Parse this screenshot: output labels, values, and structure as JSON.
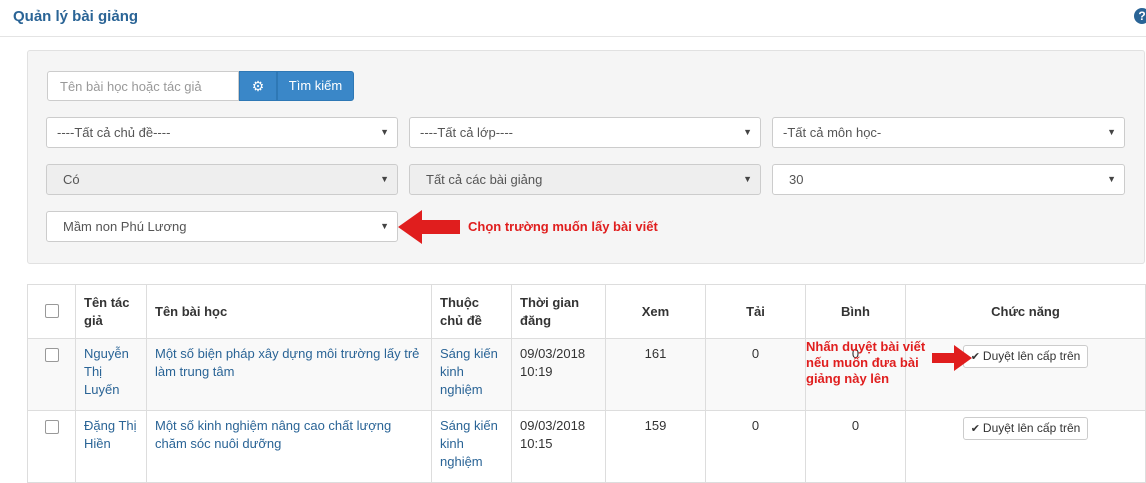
{
  "header": {
    "title": "Quản lý bài giảng",
    "help_icon": "?"
  },
  "search": {
    "placeholder": "Tên bài học hoặc tác giả",
    "gear_icon": "⚙",
    "button_label": "Tìm kiếm"
  },
  "filters": {
    "topic": "----Tất cả chủ đề----",
    "class": "----Tất cả lớp----",
    "subject": "-Tất cả môn học-",
    "status": "Có",
    "lesson_type": "Tất cả các bài giảng",
    "page_size": "30",
    "school": "Mầm non Phú Lương"
  },
  "annotations": {
    "school_hint": "Chọn trường muốn lấy bài viết",
    "approve_hint": "Nhấn duyệt bài viết nếu muốn đưa bài giảng này lên"
  },
  "table": {
    "columns": {
      "author": "Tên tác giả",
      "lesson": "Tên bài học",
      "topic": "Thuộc chủ đề",
      "posted": "Thời gian đăng",
      "views": "Xem",
      "downloads": "Tải",
      "comments": "Bình",
      "actions": "Chức năng"
    },
    "rows": [
      {
        "author": "Nguyễn Thị Luyến",
        "lesson": "Một số biện pháp xây dựng môi trường lấy trẻ làm trung tâm",
        "topic": "Sáng kiến kinh nghiệm",
        "posted": "09/03/2018 10:19",
        "views": "161",
        "downloads": "0",
        "comments": "0",
        "action": "Duyệt lên cấp trên"
      },
      {
        "author": "Đặng Thị Hiền",
        "lesson": "Một số kinh nghiệm nâng cao chất lượng chăm sóc nuôi dưỡng",
        "topic": "Sáng kiến kinh nghiệm",
        "posted": "09/03/2018 10:15",
        "views": "159",
        "downloads": "0",
        "comments": "0",
        "action": "Duyệt lên cấp trên"
      }
    ]
  },
  "colors": {
    "accent": "#3a87c8",
    "link": "#2a6496",
    "annotation": "#e01e1e"
  }
}
